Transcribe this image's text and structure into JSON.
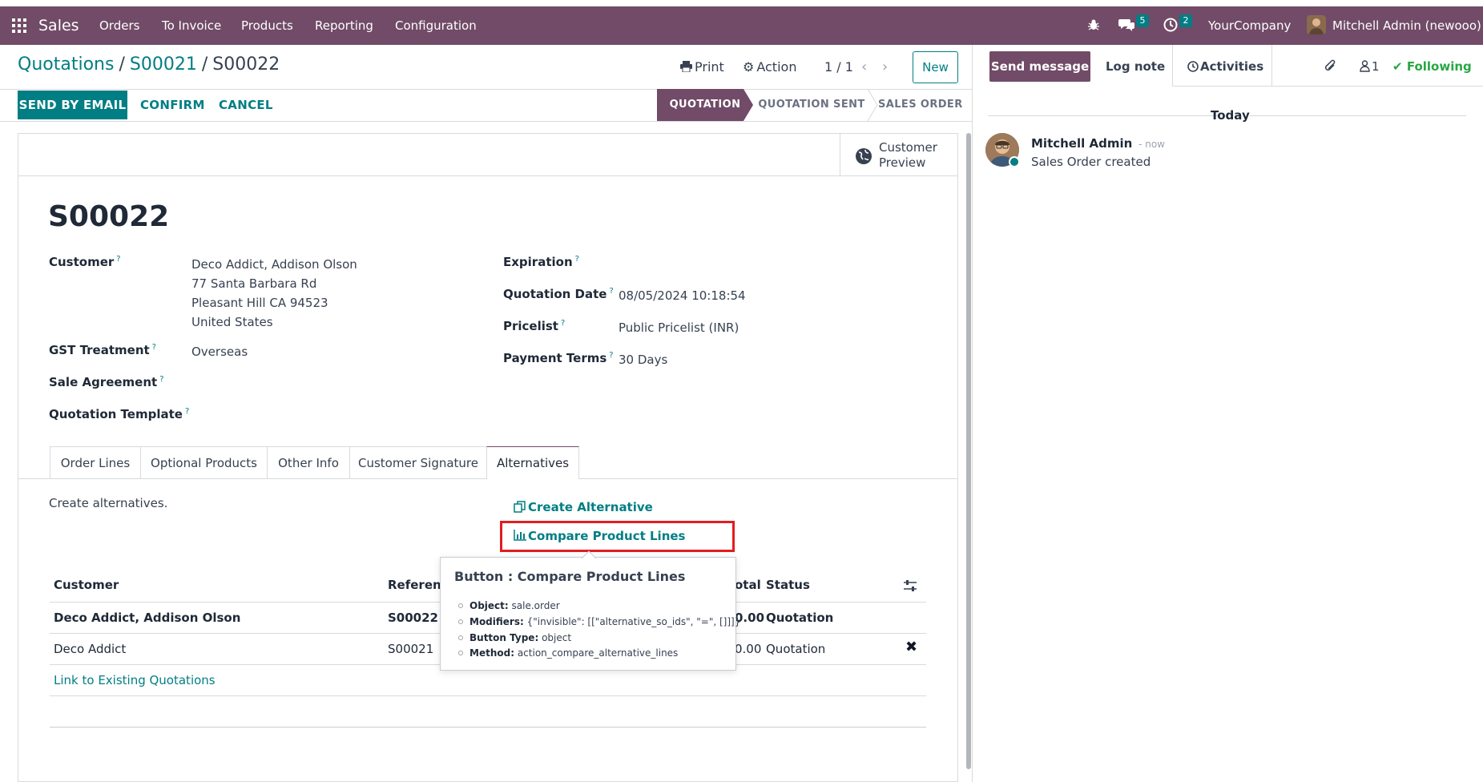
{
  "navbar": {
    "app_name": "Sales",
    "menu": [
      "Orders",
      "To Invoice",
      "Products",
      "Reporting",
      "Configuration"
    ],
    "messages_badge": "5",
    "activities_badge": "2",
    "company": "YourCompany",
    "user": "Mitchell Admin (newooo)"
  },
  "breadcrumb": {
    "root": "Quotations",
    "parent": "S00021",
    "current": "S00022"
  },
  "control": {
    "print_label": "Print",
    "action_label": "Action",
    "pager": "1 / 1",
    "new_label": "New"
  },
  "statusbar": {
    "send_by_email": "SEND BY EMAIL",
    "confirm": "CONFIRM",
    "cancel": "CANCEL",
    "stages": [
      "QUOTATION",
      "QUOTATION SENT",
      "SALES ORDER"
    ],
    "active_stage": "QUOTATION"
  },
  "sheet": {
    "customer_preview": [
      "Customer",
      "Preview"
    ],
    "name": "S00022",
    "fields": {
      "customer_label": "Customer",
      "customer_lines": [
        "Deco Addict, Addison Olson",
        "77 Santa Barbara Rd",
        "Pleasant Hill CA 94523",
        "United States"
      ],
      "gst_label": "GST Treatment",
      "gst_value": "Overseas",
      "agreement_label": "Sale Agreement",
      "template_label": "Quotation Template",
      "expiration_label": "Expiration",
      "quotation_date_label": "Quotation Date",
      "quotation_date_value": "08/05/2024 10:18:54",
      "pricelist_label": "Pricelist",
      "pricelist_value": "Public Pricelist (INR)",
      "payment_terms_label": "Payment Terms",
      "payment_terms_value": "30 Days",
      "help_mark": "?"
    },
    "tabs": [
      "Order Lines",
      "Optional Products",
      "Other Info",
      "Customer Signature",
      "Alternatives"
    ],
    "active_tab": "Alternatives",
    "alternatives": {
      "helper_text": "Create alternatives.",
      "create_alternative": "Create Alternative",
      "compare_product_lines": "Compare Product Lines",
      "columns": [
        "Customer",
        "Referenc",
        "otal",
        "Status"
      ],
      "rows": [
        {
          "customer": "Deco Addict, Addison Olson",
          "reference": "S00022",
          "total": "0.00",
          "status": "Quotation",
          "bold": true
        },
        {
          "customer": "Deco Addict",
          "reference": "S00021",
          "total": "0.00",
          "status": "Quotation",
          "bold": false
        }
      ],
      "link_existing": "Link to Existing Quotations"
    }
  },
  "tooltip": {
    "title": "Button : Compare Product Lines",
    "lines": [
      {
        "key": "Object:",
        "value": "sale.order"
      },
      {
        "key": "Modifiers:",
        "value": "{\"invisible\": [[\"alternative_so_ids\", \"=\", []]]}"
      },
      {
        "key": "Button Type:",
        "value": "object"
      },
      {
        "key": "Method:",
        "value": "action_compare_alternative_lines"
      }
    ]
  },
  "chatter": {
    "send_message": "Send message",
    "log_note": "Log note",
    "activities": "Activities",
    "followers_count": "1",
    "following": "Following",
    "date_separator": "Today",
    "message": {
      "author": "Mitchell Admin",
      "time": "- now",
      "body": "Sales Order created"
    }
  },
  "colors": {
    "brand": "#714b67",
    "accent": "#017e84",
    "highlight": "#e11d21"
  }
}
